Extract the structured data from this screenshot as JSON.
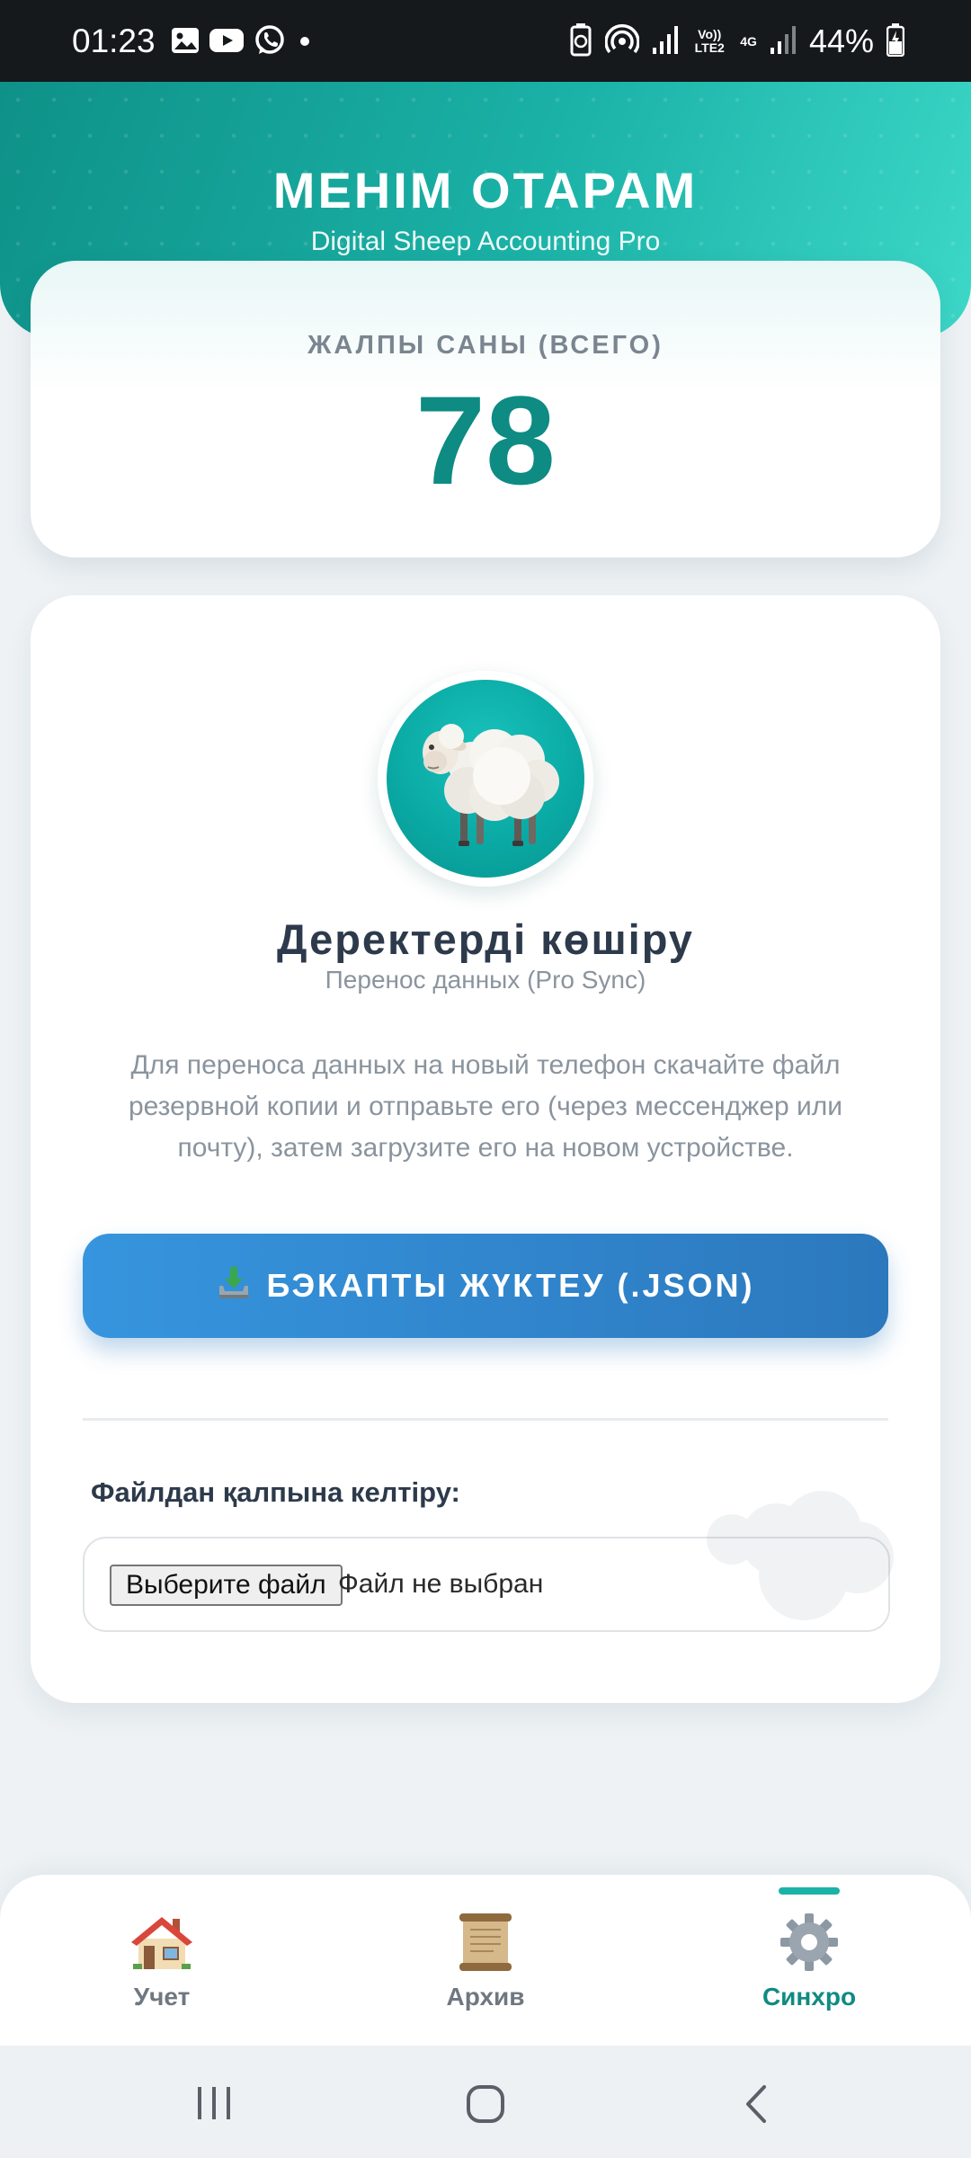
{
  "status_bar": {
    "time": "01:23",
    "battery": "44%",
    "network_volte": "Vo)) LTE2",
    "network_type": "4G",
    "notification_icons": [
      "gallery-icon",
      "youtube-icon",
      "whatsapp-icon",
      "dot-icon"
    ],
    "system_icons": [
      "battery-saver-icon",
      "hotspot-icon",
      "signal-icon",
      "signal-icon",
      "battery-icon"
    ]
  },
  "header": {
    "title": "МЕНІМ ОТАРАМ",
    "subtitle": "Digital Sheep Accounting Pro"
  },
  "total": {
    "label": "ЖАЛПЫ САНЫ (ВСЕГО)",
    "value": "78"
  },
  "sync": {
    "avatar_icon": "sheep-icon",
    "title": "Деректерді көшіру",
    "subtitle": "Перенос данных (Pro Sync)",
    "description": "Для переноса данных на новый телефон скачайте файл резервной копии и отправьте его (через мессенджер или почту), затем загрузите его на новом устройстве.",
    "backup_button": {
      "icon": "download-tray-icon",
      "label": "БЭКАПТЫ ЖҮКТЕУ (.JSON)"
    },
    "restore_label": "Файлдан қалпына келтіру:",
    "file_input": {
      "button_label": "Выберите файл",
      "status": "Файл не выбран"
    }
  },
  "bottom_nav": {
    "items": [
      {
        "label": "Учет",
        "icon": "house-icon",
        "active": false
      },
      {
        "label": "Архив",
        "icon": "scroll-icon",
        "active": false
      },
      {
        "label": "Синхро",
        "icon": "gear-icon",
        "active": true
      }
    ]
  },
  "colors": {
    "primary_teal": "#0e8b83",
    "header_gradient_start": "#0e9188",
    "header_gradient_end": "#3dd8c8",
    "button_blue": "#3695de",
    "text_dark": "#2d3a4b",
    "text_muted": "#8a949e"
  }
}
